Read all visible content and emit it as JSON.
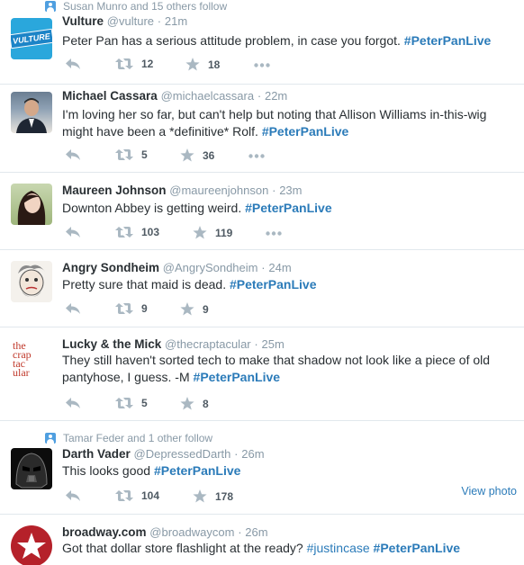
{
  "tweets": [
    {
      "context": "Susan Munro and 15 others follow",
      "name": "Vulture",
      "handle": "@vulture",
      "time": "21m",
      "text_parts": [
        "Peter Pan has a serious attitude problem, in case you forgot. "
      ],
      "hashtags": [
        "#PeterPanLive"
      ],
      "retweets": "12",
      "favorites": "18",
      "avatar": "vulture-logo",
      "avatar_text": "VULTURE",
      "avatar_color": "#2aa7dc"
    },
    {
      "name": "Michael Cassara",
      "handle": "@michaelcassara",
      "time": "22m",
      "text_parts": [
        "I'm loving her so far, but can't help but noting that Allison Williams in-this-wig might have been a *definitive* Rolf. "
      ],
      "hashtags": [
        "#PeterPanLive"
      ],
      "retweets": "5",
      "favorites": "36",
      "avatar": "man-in-suit-photo"
    },
    {
      "name": "Maureen Johnson",
      "handle": "@maureenjohnson",
      "time": "23m",
      "text_parts": [
        "Downton Abbey is getting weird. "
      ],
      "hashtags": [
        "#PeterPanLive"
      ],
      "retweets": "103",
      "favorites": "119",
      "avatar": "woman-portrait-photo"
    },
    {
      "name": "Angry Sondheim",
      "handle": "@AngrySondheim",
      "time": "24m",
      "text_parts": [
        "Pretty sure that maid is dead. "
      ],
      "hashtags": [
        "#PeterPanLive"
      ],
      "retweets": "9",
      "favorites": "9",
      "avatar": "caricature-drawing"
    },
    {
      "name": "Lucky & the Mick",
      "handle": "@thecraptacular",
      "time": "25m",
      "text_parts": [
        "They still haven't sorted tech to make that shadow not look like a piece of old pantyhose, I guess. -M "
      ],
      "hashtags": [
        "#PeterPanLive"
      ],
      "retweets": "5",
      "favorites": "8",
      "avatar": "craptacular-logo",
      "avatar_text": [
        "the",
        "crap",
        "tac",
        "ular"
      ],
      "avatar_color": "#c0392b"
    },
    {
      "context": "Tamar Feder and 1 other follow",
      "name": "Darth Vader",
      "handle": "@DepressedDarth",
      "time": "26m",
      "text_parts": [
        "This looks good "
      ],
      "hashtags": [
        "#PeterPanLive"
      ],
      "retweets": "104",
      "favorites": "178",
      "avatar": "darth-vader-helmet",
      "view_photo": "View photo"
    },
    {
      "name": "broadway.com",
      "handle": "@broadwaycom",
      "time": "26m",
      "text_parts": [
        "Got that dollar store flashlight at the ready? "
      ],
      "hashtags": [
        "#justincase",
        "#PeterPanLive"
      ],
      "avatar": "broadway-star-logo",
      "avatar_color": "#b5212a"
    }
  ],
  "colors": {
    "hashtag": "#2b7bb9",
    "secondary_text": "#8899a6",
    "divider": "#e1e8ed"
  },
  "icons": [
    "reply-icon",
    "retweet-icon",
    "favorite-star-icon",
    "more-dots-icon",
    "follow-context-person-icon"
  ]
}
